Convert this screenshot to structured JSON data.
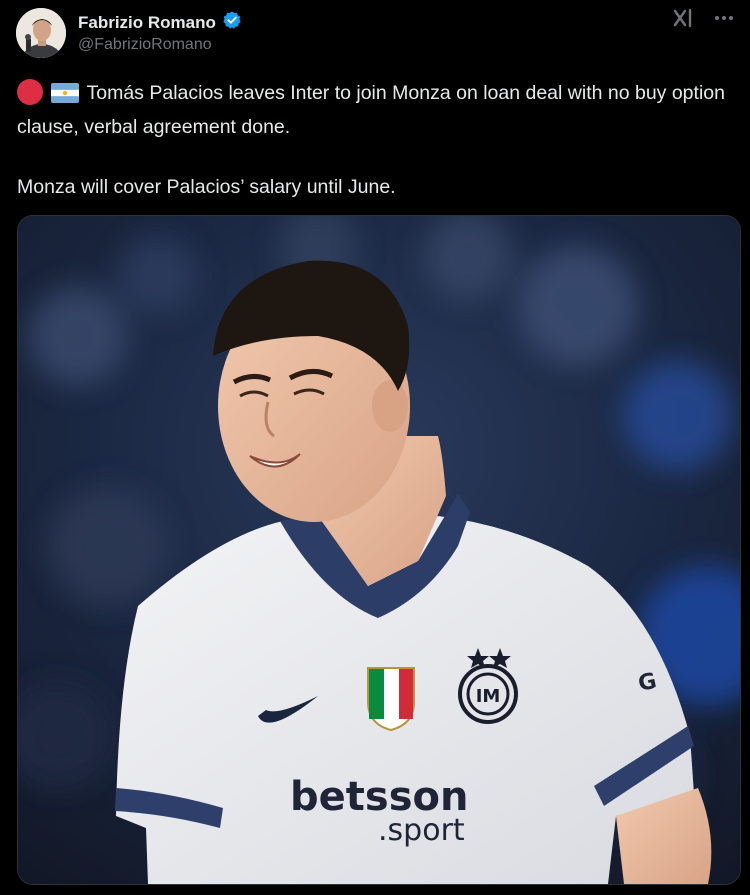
{
  "author": {
    "display_name": "Fabrizio Romano",
    "handle": "@FabrizioRomano",
    "verified": true
  },
  "tweet": {
    "line1": "Tomás Palacios leaves Inter to join Monza on loan deal with no buy option clause, verbal agreement done.",
    "line2": "Monza will cover Palacios’ salary until June."
  },
  "emojis": [
    "red-circle",
    "argentina-flag"
  ],
  "media": {
    "chest_logo": "betsson",
    "chest_sub": ".sport",
    "sleeve_text": "G"
  },
  "colors": {
    "background": "#000000",
    "text": "#e7e9ea",
    "secondary_text": "#71767b",
    "verified_blue": "#1d9bf0"
  }
}
